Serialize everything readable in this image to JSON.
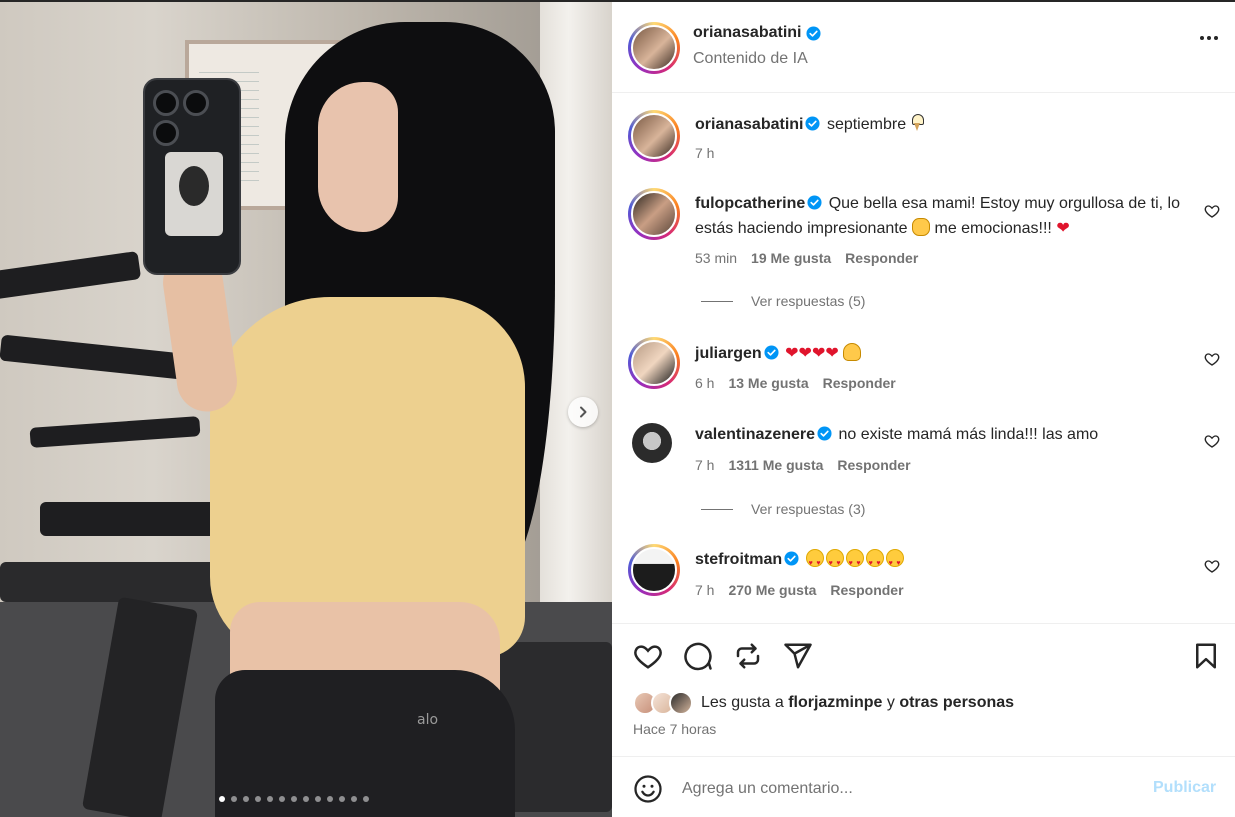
{
  "post": {
    "author": "orianasabatini",
    "subtitle": "Contenido de IA",
    "caption_user": "orianasabatini",
    "caption_text": "septiembre",
    "caption_emoji": "ice-cream-emoji",
    "caption_time": "7 h",
    "media": {
      "current_slide": 1,
      "total_slides": 13
    }
  },
  "comments": [
    {
      "user": "fulopcatherine",
      "text": "Que bella esa mami! Estoy muy orgullosa de ti, lo estás haciendo impresionante",
      "text_2": "me emocionas!!!",
      "time": "53 min",
      "likes": "19 Me gusta",
      "reply": "Responder",
      "view_replies": "Ver respuestas (5)"
    },
    {
      "user": "juliargen",
      "text": "❤❤❤❤",
      "time": "6 h",
      "likes": "13 Me gusta",
      "reply": "Responder"
    },
    {
      "user": "valentinazenere",
      "text": "no existe mamá más linda!!! las amo",
      "time": "7 h",
      "likes": "1311 Me gusta",
      "reply": "Responder",
      "view_replies": "Ver respuestas (3)"
    },
    {
      "user": "stefroitman",
      "text": "",
      "time": "7 h",
      "likes": "270 Me gusta",
      "reply": "Responder"
    }
  ],
  "footer": {
    "likes_prefix": "Les gusta a",
    "likes_user": "florjazminpe",
    "likes_connector": "y",
    "likes_others": "otras personas",
    "timestamp": "Hace 7 horas",
    "comment_placeholder": "Agrega un comentario...",
    "publish_label": "Publicar"
  },
  "colors": {
    "accent": "#0095f6",
    "publish_disabled": "#b2dffc",
    "secondary_text": "#737373",
    "heart": "#e0142c"
  }
}
